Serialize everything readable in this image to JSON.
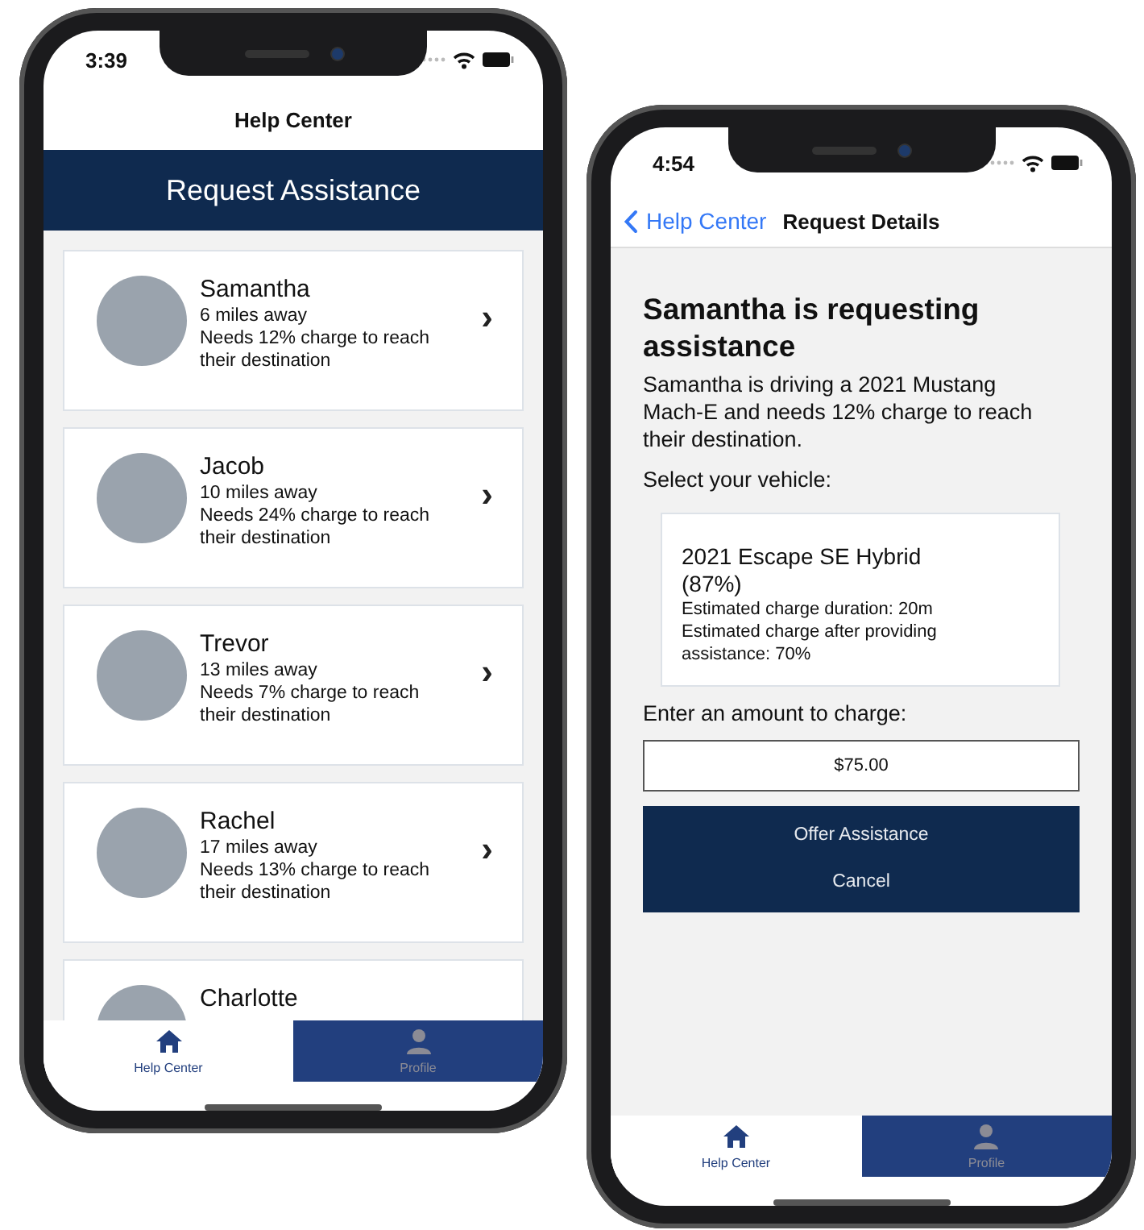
{
  "phones": [
    {
      "kind": "list",
      "status_bar": {
        "time": "3:39"
      },
      "nav": {
        "title": "Help Center"
      },
      "header": {
        "title": "Request Assistance"
      },
      "requests": [
        {
          "name": "Samantha",
          "distance": "6 miles away",
          "need": "Needs 12% charge to reach their destination",
          "chevron": "›"
        },
        {
          "name": "Jacob",
          "distance": "10 miles away",
          "need": "Needs 24% charge to reach their destination",
          "chevron": "›"
        },
        {
          "name": "Trevor",
          "distance": "13 miles away",
          "need": "Needs 7% charge to reach their destination",
          "chevron": "›"
        },
        {
          "name": "Rachel",
          "distance": "17 miles away",
          "need": "Needs 13% charge to reach their destination",
          "chevron": "›"
        },
        {
          "name": "Charlotte"
        }
      ],
      "tab_bar": [
        {
          "label": "Help Center",
          "selected": true
        },
        {
          "label": "Profile",
          "selected": false
        }
      ]
    },
    {
      "kind": "detail",
      "status_bar": {
        "time": "4:54"
      },
      "nav": {
        "back": "Help Center",
        "title": "Request Details"
      },
      "heading": "Samantha is requesting assistance",
      "description": "Samantha is driving a 2021 Mustang Mach-E and needs 12% charge to reach their destination.",
      "vehicle_label": "Select your vehicle:",
      "vehicle": {
        "name": "2021 Escape SE Hybrid (87%)",
        "details": [
          "Estimated charge duration: 20m",
          "Estimated charge after providing assistance: 70%"
        ]
      },
      "amount_label": "Enter an amount to charge:",
      "amount": {
        "value": "$75.00"
      },
      "buttons": [
        "Offer Assistance",
        "Cancel"
      ],
      "tab_bar": [
        {
          "label": "Help Center",
          "selected": true
        },
        {
          "label": "Profile",
          "selected": false
        }
      ]
    }
  ]
}
